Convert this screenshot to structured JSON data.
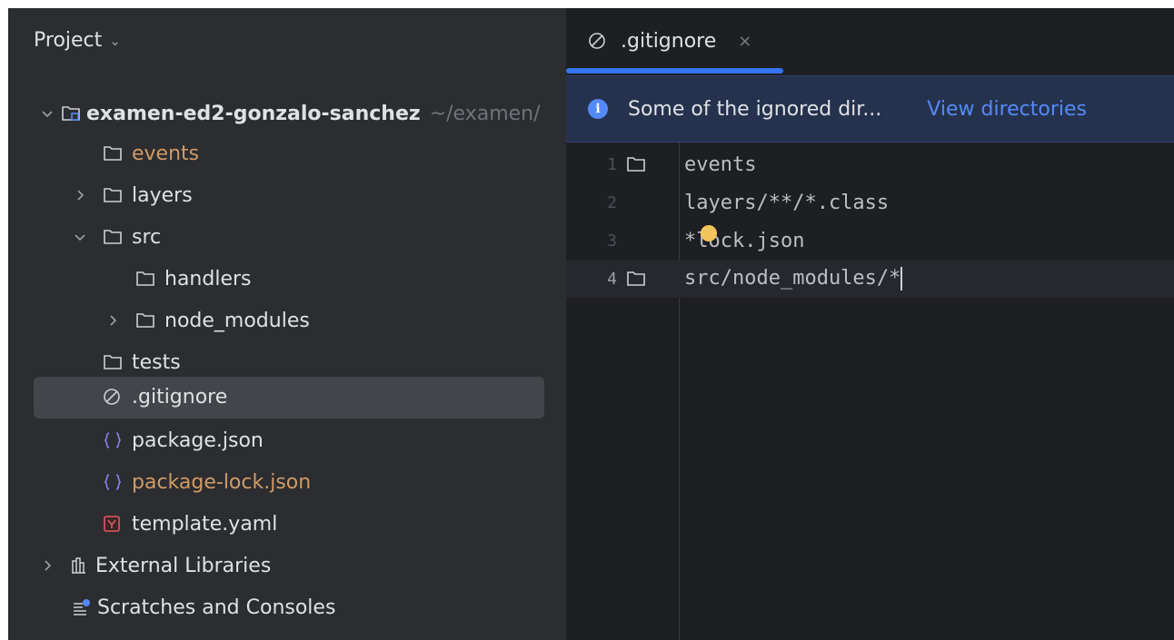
{
  "project": {
    "title": "Project",
    "tree": [
      {
        "label": "examen-ed2-gonzalo-sanchez",
        "path": "~/examen/",
        "icon": "module-folder-icon",
        "expanded": true
      },
      {
        "label": "events",
        "icon": "folder-icon",
        "color": "#d19a66"
      },
      {
        "label": "layers",
        "icon": "folder-icon"
      },
      {
        "label": "src",
        "icon": "folder-icon",
        "expanded": true
      },
      {
        "label": "handlers",
        "icon": "folder-icon"
      },
      {
        "label": "node_modules",
        "icon": "folder-icon"
      },
      {
        "label": "tests",
        "icon": "folder-icon"
      },
      {
        "label": ".gitignore",
        "icon": "ignore-icon",
        "selected": true
      },
      {
        "label": "package.json",
        "icon": "json-icon"
      },
      {
        "label": "package-lock.json",
        "icon": "json-icon",
        "color": "#d19a66"
      },
      {
        "label": "template.yaml",
        "icon": "yaml-icon"
      },
      {
        "label": "External Libraries",
        "icon": "library-icon"
      },
      {
        "label": "Scratches and Consoles",
        "icon": "scratches-icon"
      }
    ]
  },
  "editor": {
    "tab": {
      "label": ".gitignore",
      "close": "×"
    },
    "banner": {
      "message": "Some of the ignored dir...",
      "link": "View directories"
    },
    "lines": [
      {
        "n": "1",
        "text": "events"
      },
      {
        "n": "2",
        "text": "layers/**/*.class"
      },
      {
        "n": "3",
        "text": "*lock.json"
      },
      {
        "n": "4",
        "text": "src/node_modules/*"
      }
    ]
  },
  "colors": {
    "accent": "#3574f0",
    "modified": "#d19a66",
    "banner": "#25324d"
  }
}
